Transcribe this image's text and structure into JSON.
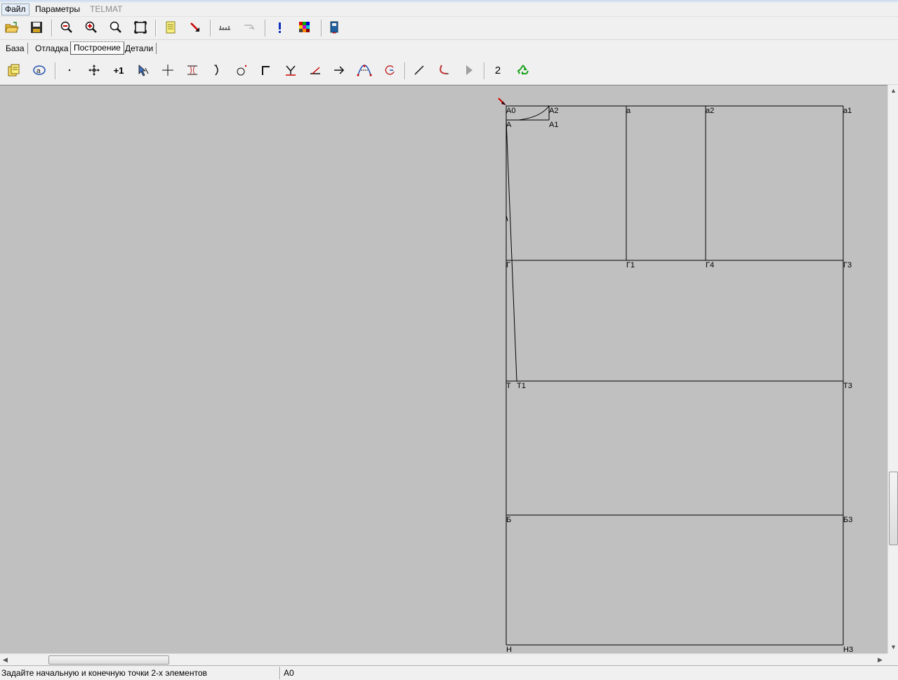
{
  "menu": {
    "file": "Файл",
    "params": "Параметры",
    "telmat": "TELMAT"
  },
  "toolbar_main": [
    {
      "icon": "open-folder-icon"
    },
    {
      "icon": "save-icon"
    },
    {
      "icon": "zoom-out-icon"
    },
    {
      "icon": "zoom-in-icon"
    },
    {
      "icon": "zoom-icon"
    },
    {
      "icon": "fit-window-icon"
    },
    {
      "icon": "document-icon"
    },
    {
      "icon": "pointer-arrow-icon"
    },
    {
      "icon": "ruler-icon"
    },
    {
      "icon": "measure-angle-icon"
    },
    {
      "icon": "exclamation-icon"
    },
    {
      "icon": "color-palette-icon"
    },
    {
      "icon": "book-icon"
    }
  ],
  "tabs": {
    "base": "База",
    "debug": "Отладка",
    "build": "Построение",
    "details": "Детали"
  },
  "toolbar_build": {
    "number_label": "2",
    "plus_one_label": "+1"
  },
  "drawing": {
    "labels": {
      "A0": "А0",
      "A2": "А2",
      "A": "А",
      "A1": "А1",
      "a": "а",
      "a2": "а2",
      "a1": "а1",
      "G": "Г",
      "G1": "Г1",
      "G4": "Г4",
      "G3": "Г3",
      "T": "Т",
      "T1": "Т1",
      "T3": "Т3",
      "B": "Б",
      "B3": "Б3",
      "N": "Н",
      "N3": "Н3"
    }
  },
  "status": {
    "hint": "Задайте начальную и конечную точки 2-х элементов",
    "current_point": "А0"
  }
}
